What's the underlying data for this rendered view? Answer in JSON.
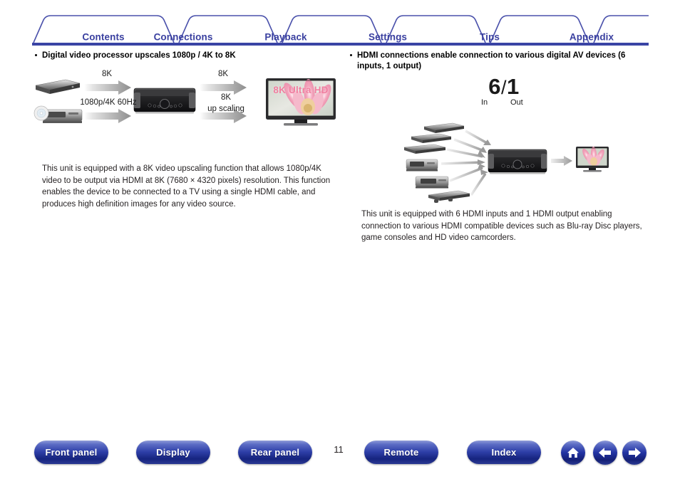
{
  "tabs": [
    {
      "label": "Contents"
    },
    {
      "label": "Connections"
    },
    {
      "label": "Playback"
    },
    {
      "label": "Settings"
    },
    {
      "label": "Tips"
    },
    {
      "label": "Appendix"
    }
  ],
  "left_column": {
    "heading": "Digital video processor upscales 1080p / 4K to 8K",
    "diagram": {
      "labels": [
        {
          "text": "8K"
        },
        {
          "text": "1080p/4K 60Hz"
        },
        {
          "text": "8K"
        },
        {
          "text": "8K"
        },
        {
          "text": "up scaling"
        }
      ],
      "tv_overlay": "8K Ultra HD",
      "devices": [
        "blu-ray-player-device",
        "disc-player-device",
        "av-receiver-device",
        "television-device"
      ]
    },
    "paragraph": "This unit is equipped with a 8K video upscaling function that allows 1080p/4K video to be output via HDMI at 8K (7680 × 4320 pixels) resolution. This function enables the device to be connected to a TV using a single HDMI cable, and produces high definition images for any video source."
  },
  "right_column": {
    "heading": "HDMI connections enable connection to various digital AV devices (6 inputs, 1 output)",
    "ratio": {
      "inputs": "6",
      "separator": "/",
      "outputs": "1",
      "in_label": "In",
      "out_label": "Out"
    },
    "diagram": {
      "devices": [
        "blu-ray-player-device",
        "cd-player-device",
        "dvd-player-device",
        "media-player-device",
        "cassette-deck-device",
        "game-console-device",
        "av-receiver-device",
        "television-device"
      ]
    },
    "paragraph": "This unit is equipped with 6 HDMI inputs and 1 HDMI output enabling connection to various HDMI compatible devices such as Blu-ray Disc players, game consoles and HD video camcorders."
  },
  "footer": {
    "buttons": [
      {
        "label": "Front panel"
      },
      {
        "label": "Display"
      },
      {
        "label": "Rear panel"
      },
      {
        "label": "Remote"
      },
      {
        "label": "Index"
      }
    ],
    "page_number": "11",
    "icons": [
      {
        "name": "home-icon"
      },
      {
        "name": "arrow-left-icon"
      },
      {
        "name": "arrow-right-icon"
      }
    ]
  },
  "colors": {
    "tab_text": "#3a40a0",
    "tab_outline": "#4a51ab",
    "rule": "#3a44a5",
    "button_blue": "#2233a3",
    "body_text": "#231f20"
  }
}
